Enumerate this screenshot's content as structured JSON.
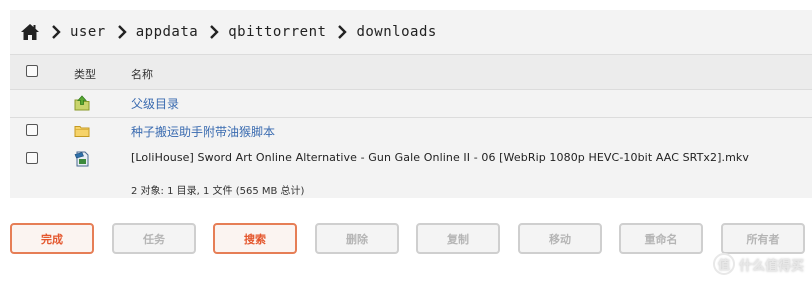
{
  "breadcrumb": {
    "home_icon": "home-icon",
    "separator_icon": "chevron-right-icon",
    "segments": [
      "user",
      "appdata",
      "qbittorrent",
      "downloads"
    ]
  },
  "table": {
    "headers": {
      "type": "类型",
      "name": "名称"
    },
    "rows": [
      {
        "icon": "folder-up-icon",
        "name": "父级目录",
        "has_checkbox": false,
        "kind": "link"
      },
      {
        "icon": "folder-icon",
        "name": "种子搬运助手附带油猴脚本",
        "has_checkbox": true,
        "kind": "link"
      },
      {
        "icon": "video-file-icon",
        "name": "[LoliHouse] Sword Art Online Alternative - Gun Gale Online II - 06 [WebRip 1080p HEVC-10bit AAC SRTx2].mkv",
        "has_checkbox": true,
        "kind": "file"
      }
    ],
    "summary": "2 对象: 1 目录, 1 文件 (565 MB 总计)"
  },
  "buttons": [
    {
      "label": "完成",
      "state": "active"
    },
    {
      "label": "任务",
      "state": "disabled"
    },
    {
      "label": "搜索",
      "state": "active"
    },
    {
      "label": "删除",
      "state": "disabled"
    },
    {
      "label": "复制",
      "state": "disabled"
    },
    {
      "label": "移动",
      "state": "disabled"
    },
    {
      "label": "重命名",
      "state": "disabled"
    },
    {
      "label": "所有者",
      "state": "disabled"
    }
  ],
  "colors": {
    "link": "#3a6bb0",
    "accent_border": "#e67e56",
    "accent_text": "#e4572e",
    "disabled_text": "#b5b5b5",
    "panel_bg": "#f3f3f3"
  },
  "watermark": {
    "logo": "值",
    "text": "什么值得买"
  }
}
